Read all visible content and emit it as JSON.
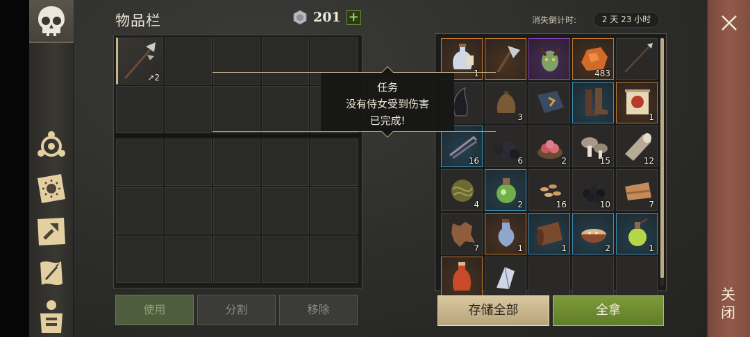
{
  "header": {
    "title": "物品栏",
    "currency_amount": "201",
    "plus_label": "+",
    "timer_label": "消失倒计时:",
    "timer_value": "2 天 23 小时"
  },
  "inventory": {
    "equipped_item": {
      "icon": "halberd-icon",
      "count": "↗2"
    }
  },
  "actions": {
    "use": "使用",
    "split": "分割",
    "remove": "移除"
  },
  "container": {
    "items": [
      {
        "icon": "water-bottle-icon",
        "count": "1",
        "rarity": "orange"
      },
      {
        "icon": "axe-icon",
        "count": "",
        "rarity": "orange"
      },
      {
        "icon": "creature-portrait-icon",
        "count": "",
        "rarity": "purple"
      },
      {
        "icon": "copper-ore-icon",
        "count": "483",
        "rarity": "orange"
      },
      {
        "icon": "spear-icon",
        "count": "",
        "rarity": "plain"
      },
      {
        "icon": "dark-helmet-icon",
        "count": "",
        "rarity": "plain"
      },
      {
        "icon": "cloth-sack-icon",
        "count": "3",
        "rarity": "plain"
      },
      {
        "icon": "book-icon",
        "count": "",
        "rarity": "plain"
      },
      {
        "icon": "boots-icon",
        "count": "",
        "rarity": "blue"
      },
      {
        "icon": "map-scroll-icon",
        "count": "1",
        "rarity": "orange"
      },
      {
        "icon": "metal-rods-icon",
        "count": "16",
        "rarity": "blue"
      },
      {
        "icon": "coal-icon",
        "count": "6",
        "rarity": "plain"
      },
      {
        "icon": "raw-meat-icon",
        "count": "2",
        "rarity": "plain"
      },
      {
        "icon": "mushroom-icon",
        "count": "15",
        "rarity": "plain"
      },
      {
        "icon": "log-icon",
        "count": "12",
        "rarity": "plain"
      },
      {
        "icon": "fiber-ball-icon",
        "count": "4",
        "rarity": "plain"
      },
      {
        "icon": "green-potion-flask-icon",
        "count": "2",
        "rarity": "blue"
      },
      {
        "icon": "seeds-icon",
        "count": "16",
        "rarity": "plain"
      },
      {
        "icon": "black-berries-icon",
        "count": "10",
        "rarity": "plain"
      },
      {
        "icon": "leather-roll-icon",
        "count": "7",
        "rarity": "plain"
      },
      {
        "icon": "hide-icon",
        "count": "7",
        "rarity": "plain"
      },
      {
        "icon": "blue-potion-icon",
        "count": "1",
        "rarity": "orange"
      },
      {
        "icon": "leather-scroll-icon",
        "count": "1",
        "rarity": "blue"
      },
      {
        "icon": "stew-bowl-icon",
        "count": "2",
        "rarity": "blue"
      },
      {
        "icon": "green-potion-icon",
        "count": "1",
        "rarity": "blue"
      },
      {
        "icon": "red-bottle-icon",
        "count": "",
        "rarity": "orange"
      },
      {
        "icon": "crystal-shard-icon",
        "count": "",
        "rarity": "plain"
      },
      {
        "icon": "",
        "count": "",
        "rarity": "plain"
      },
      {
        "icon": "",
        "count": "",
        "rarity": "plain"
      },
      {
        "icon": "",
        "count": "",
        "rarity": "plain"
      }
    ]
  },
  "buttons": {
    "store_all": "存储全部",
    "take_all": "全拿"
  },
  "tooltip": {
    "title": "任务",
    "line1": "没有侍女受到伤害",
    "line2": "已完成!"
  },
  "close": {
    "label": "关闭"
  },
  "colors": {
    "accent_green": "#7d9a3a",
    "accent_tan": "#d8c7a0",
    "rarity_orange": "#c2782f",
    "rarity_blue": "#3a8fb5",
    "rarity_purple": "#8a3fb3"
  }
}
